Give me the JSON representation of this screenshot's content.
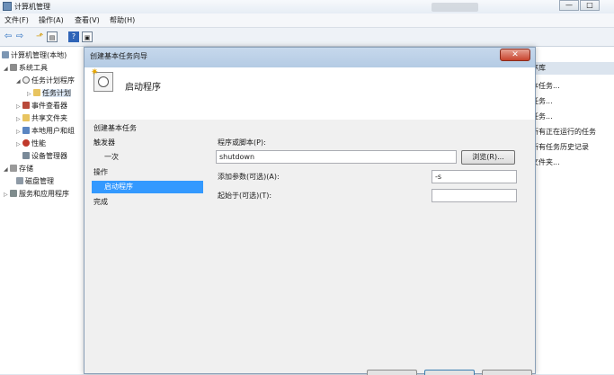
{
  "window": {
    "title": "计算机管理",
    "controls": [
      "—",
      "□"
    ]
  },
  "menu": [
    "文件(F)",
    "操作(A)",
    "查看(V)",
    "帮助(H)"
  ],
  "toolbar_icons": [
    "back-arrow-icon",
    "forward-arrow-icon",
    "up-folder-icon",
    "show-hide-tree-icon",
    "help-icon",
    "properties-icon"
  ],
  "tree": [
    {
      "label": "计算机管理(本地)",
      "icon": "computer-icon",
      "indent": 0,
      "arrow": ""
    },
    {
      "label": "系统工具",
      "icon": "tools-icon",
      "indent": 1,
      "arrow": "◢"
    },
    {
      "label": "任务计划程序",
      "icon": "clock-icon",
      "indent": 2,
      "arrow": "◢"
    },
    {
      "label": "任务计划",
      "icon": "folder-icon",
      "indent": 3,
      "arrow": "▷",
      "selected": true
    },
    {
      "label": "事件查看器",
      "icon": "event-viewer-icon",
      "indent": 2,
      "arrow": "▷"
    },
    {
      "label": "共享文件夹",
      "icon": "shared-folder-icon",
      "indent": 2,
      "arrow": "▷"
    },
    {
      "label": "本地用户和组",
      "icon": "users-icon",
      "indent": 2,
      "arrow": "▷"
    },
    {
      "label": "性能",
      "icon": "performance-icon",
      "indent": 2,
      "arrow": "▷"
    },
    {
      "label": "设备管理器",
      "icon": "device-manager-icon",
      "indent": 2,
      "arrow": ""
    },
    {
      "label": "存储",
      "icon": "storage-icon",
      "indent": 1,
      "arrow": "◢"
    },
    {
      "label": "磁盘管理",
      "icon": "disk-icon",
      "indent": 2,
      "arrow": ""
    },
    {
      "label": "服务和应用程序",
      "icon": "services-icon",
      "indent": 1,
      "arrow": "▷"
    }
  ],
  "actions_pane": {
    "header": "序库",
    "items": [
      "本任务...",
      "任务...",
      "任务...",
      "所有正在运行的任务",
      "所有任务历史记录",
      "文件夹...",
      "",
      "",
      ""
    ]
  },
  "wizard": {
    "title": "创建基本任务向导",
    "close_label": "✕",
    "heading": "启动程序",
    "steps": [
      {
        "label": "创建基本任务",
        "current": false,
        "indent": 0
      },
      {
        "label": "触发器",
        "current": false,
        "indent": 0
      },
      {
        "label": "一次",
        "current": false,
        "indent": 1
      },
      {
        "label": "操作",
        "current": false,
        "indent": 0
      },
      {
        "label": "启动程序",
        "current": true,
        "indent": 1
      },
      {
        "label": "完成",
        "current": false,
        "indent": 0
      }
    ],
    "program_label": "程序或脚本(P):",
    "program_value": "shutdown",
    "browse_label": "浏览(R)...",
    "args_label": "添加参数(可选)(A):",
    "args_value": "-s",
    "start_in_label": "起始于(可选)(T):",
    "start_in_value": ""
  }
}
